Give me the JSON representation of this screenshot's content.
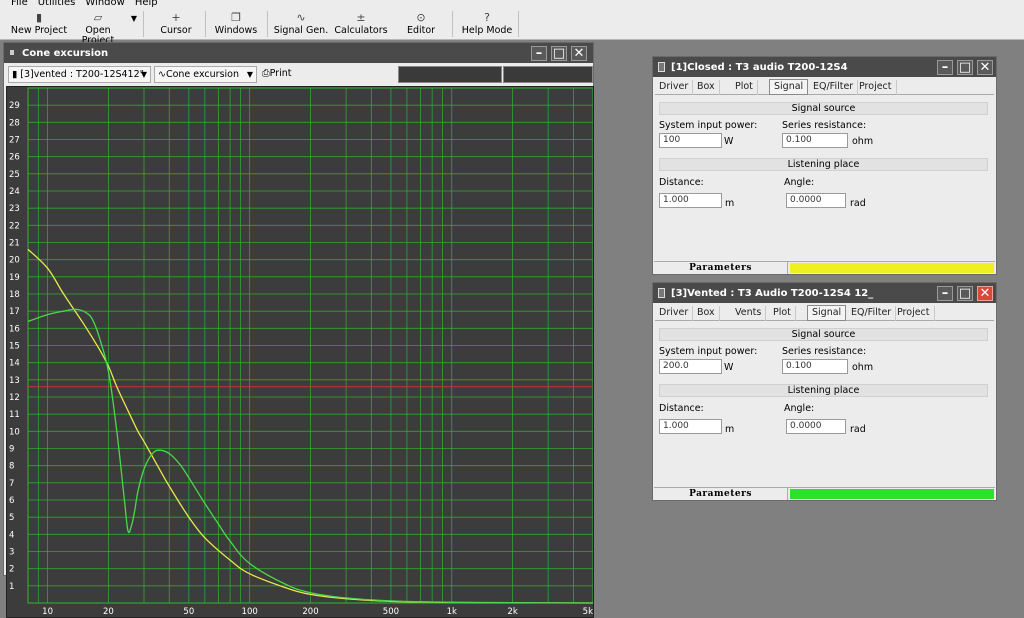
{
  "menu": [
    "File",
    "Utilities",
    "Window",
    "Help"
  ],
  "toolbar": [
    {
      "label": "New Project",
      "icon": "new-project-icon"
    },
    {
      "label": "Open Project",
      "icon": "open-project-icon"
    },
    {
      "label": "Cursor",
      "icon": "cursor-icon"
    },
    {
      "label": "Windows",
      "icon": "windows-icon"
    },
    {
      "label": "Signal Gen.",
      "icon": "signal-generator-icon"
    },
    {
      "label": "Calculators",
      "icon": "calculators-icon"
    },
    {
      "label": "Editor",
      "icon": "editor-icon"
    },
    {
      "label": "Help Mode",
      "icon": "help-icon"
    }
  ],
  "graph_window": {
    "title": "Cone excursion",
    "project_select": "[3]vented : T200-12S412\"",
    "plot_select": "Cone excursion",
    "print_label": "Print"
  },
  "chart_data": {
    "type": "line",
    "x_scale": "log",
    "xlim": [
      8,
      5000
    ],
    "ylim": [
      0,
      30
    ],
    "x_ticks": [
      {
        "v": 10,
        "label": "10"
      },
      {
        "v": 20,
        "label": "20"
      },
      {
        "v": 50,
        "label": "50"
      },
      {
        "v": 100,
        "label": "100"
      },
      {
        "v": 200,
        "label": "200"
      },
      {
        "v": 500,
        "label": "500"
      },
      {
        "v": 1000,
        "label": "1k"
      },
      {
        "v": 2000,
        "label": "2k"
      },
      {
        "v": 5000,
        "label": "5k"
      }
    ],
    "y_ticks": [
      1,
      2,
      3,
      4,
      5,
      6,
      7,
      8,
      9,
      10,
      11,
      12,
      13,
      14,
      15,
      16,
      17,
      18,
      19,
      20,
      21,
      22,
      23,
      24,
      25,
      26,
      27,
      28,
      29
    ],
    "grid": true,
    "reference_line": {
      "y": 12.6,
      "color": "#d03030"
    },
    "series": [
      {
        "color": "#e8e84a",
        "x": [
          8,
          10,
          12,
          15,
          18,
          20,
          22,
          25,
          28,
          30,
          35,
          40,
          50,
          60,
          80,
          100,
          150,
          200,
          300,
          500,
          800,
          1000,
          2000,
          5000
        ],
        "y": [
          20.6,
          19.5,
          18.0,
          16.3,
          14.8,
          13.8,
          12.6,
          11.2,
          10.0,
          9.4,
          8.0,
          6.8,
          5.0,
          3.8,
          2.5,
          1.7,
          0.9,
          0.5,
          0.25,
          0.1,
          0.05,
          0.03,
          0.01,
          0
        ]
      },
      {
        "color": "#4ad84a",
        "x": [
          8,
          10,
          12,
          14,
          16,
          17,
          18,
          20,
          22,
          24,
          25,
          26,
          27,
          28,
          30,
          33,
          36,
          40,
          45,
          50,
          60,
          70,
          80,
          100,
          150,
          200,
          300,
          500,
          1000,
          5000
        ],
        "y": [
          16.4,
          16.8,
          17.0,
          17.1,
          16.8,
          16.3,
          15.5,
          13.5,
          10.0,
          6.0,
          4.2,
          4.5,
          5.4,
          6.5,
          7.8,
          8.7,
          8.9,
          8.7,
          8.1,
          7.3,
          5.8,
          4.6,
          3.6,
          2.3,
          1.1,
          0.6,
          0.3,
          0.12,
          0.04,
          0
        ]
      }
    ]
  },
  "param_windows": [
    {
      "title": "[1]Closed : T3 audio T200-12S4",
      "tabs": [
        "Driver",
        "Box",
        "Plot",
        "Signal",
        "EQ/Filter",
        "Project"
      ],
      "active_tab": 3,
      "signal_source": "Signal source",
      "power_label": "System input power:",
      "power_value": "100",
      "power_unit": "W",
      "resist_label": "Series resistance:",
      "resist_value": "0.100",
      "resist_unit": "ohm",
      "listening": "Listening place",
      "dist_label": "Distance:",
      "dist_value": "1.000",
      "dist_unit": "m",
      "angle_label": "Angle:",
      "angle_value": "0.0000",
      "angle_unit": "rad",
      "status_label": "Parameters",
      "status_color": "#f0f020"
    },
    {
      "title": "[3]Vented : T3 Audio T200-12S4 12_",
      "tabs": [
        "Driver",
        "Box",
        "Vents",
        "Plot",
        "Signal",
        "EQ/Filter",
        "Project"
      ],
      "active_tab": 4,
      "signal_source": "Signal source",
      "power_label": "System input power:",
      "power_value": "200.0",
      "power_unit": "W",
      "resist_label": "Series resistance:",
      "resist_value": "0.100",
      "resist_unit": "ohm",
      "listening": "Listening place",
      "dist_label": "Distance:",
      "dist_value": "1.000",
      "dist_unit": "m",
      "angle_label": "Angle:",
      "angle_value": "0.0000",
      "angle_unit": "rad",
      "status_label": "Parameters",
      "status_color": "#30e030"
    }
  ]
}
